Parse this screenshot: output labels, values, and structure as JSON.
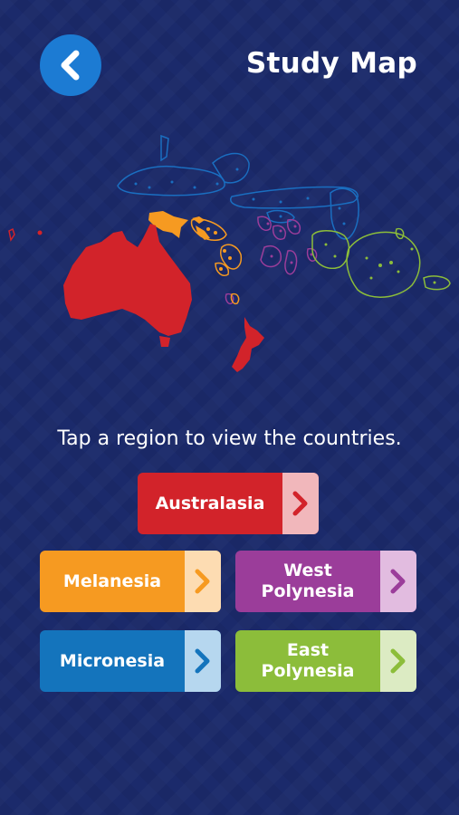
{
  "header": {
    "title": "Study Map",
    "back_icon": "chevron-left-icon"
  },
  "instruction": "Tap a region to view the countries.",
  "regions": [
    {
      "label": "Australasia",
      "color": "#d2232a",
      "arrow_bg": "#f1b7bb",
      "icon": "chevron-right-icon"
    },
    {
      "label": "Melanesia",
      "color": "#f69a21",
      "arrow_bg": "#fddcb2",
      "icon": "chevron-right-icon"
    },
    {
      "label": "West Polynesia",
      "color": "#9b3d9a",
      "arrow_bg": "#e2bce0",
      "icon": "chevron-right-icon"
    },
    {
      "label": "Micronesia",
      "color": "#1474bc",
      "arrow_bg": "#b6d7ef",
      "icon": "chevron-right-icon"
    },
    {
      "label": "East Polynesia",
      "color": "#8cbd3a",
      "arrow_bg": "#dcebc3",
      "icon": "chevron-right-icon"
    }
  ],
  "colors": {
    "background": "#1b2a6b",
    "back_button": "#1c7bd3"
  }
}
